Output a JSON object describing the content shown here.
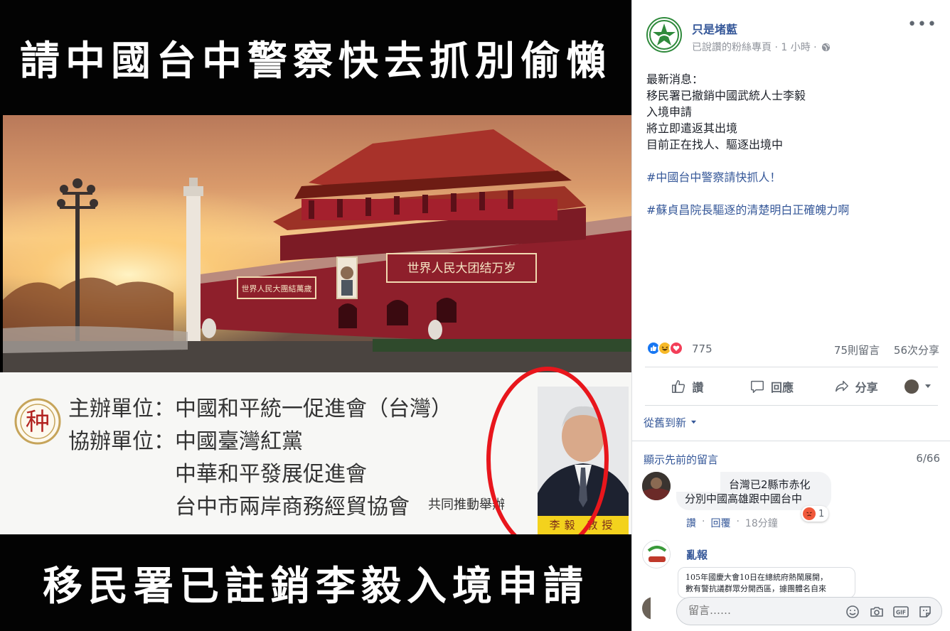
{
  "image": {
    "top_caption": "請中國台中警察快去抓別偷懶",
    "bottom_caption": "移民署已註銷李毅入境申請",
    "banner_left": "世界人民大團結萬歲",
    "banner_right": "世界人民大团结万岁",
    "flyer": {
      "seal_char": "种",
      "rows": [
        "主辦單位：中國和平統一促進會（台灣）",
        "協辦單位：中國臺灣紅黨",
        "中華和平發展促進會",
        "台中市兩岸商務經貿協會"
      ],
      "note": "共同推動舉辦",
      "portrait_name": "李毅 教授"
    },
    "colors": {
      "highlight_ring": "#e8161c",
      "band": "#030303"
    }
  },
  "post": {
    "page_name": "只是堵藍",
    "meta": "已說讚的粉絲專頁 · 1 小時 ·",
    "more_label": "•••",
    "lines": [
      "最新消息：",
      "移民署已撤銷中國武統人士李毅",
      "入境申請",
      "將立即遣返其出境",
      "目前正在找人、驅逐出境中"
    ],
    "hashtags": [
      "#中國台中警察請快抓人！",
      "#蘇貞昌院長驅逐的清楚明白正確魄力啊"
    ],
    "reaction_count": "775",
    "comments_count": "75則留言",
    "shares_count": "56次分享",
    "actions": {
      "like": "讚",
      "comment": "回應",
      "share": "分享"
    }
  },
  "comments": {
    "sort_label": "從舊到新",
    "show_previous": "顯示先前的留言",
    "previous_count": "6/66",
    "items": [
      {
        "text_line1": "台灣已2縣市赤化",
        "text_line2": "分別中國高雄跟中國台中",
        "like": "讚",
        "reply": "回覆",
        "time": "18分鐘",
        "angry_count": "1"
      },
      {
        "author": "亂報",
        "link_line1": "105年國慶大會10日在總統府熱鬧展開，",
        "link_line2": "數有警抗議群眾分開西區，據團體名自來"
      }
    ],
    "input_placeholder": "留言……"
  }
}
